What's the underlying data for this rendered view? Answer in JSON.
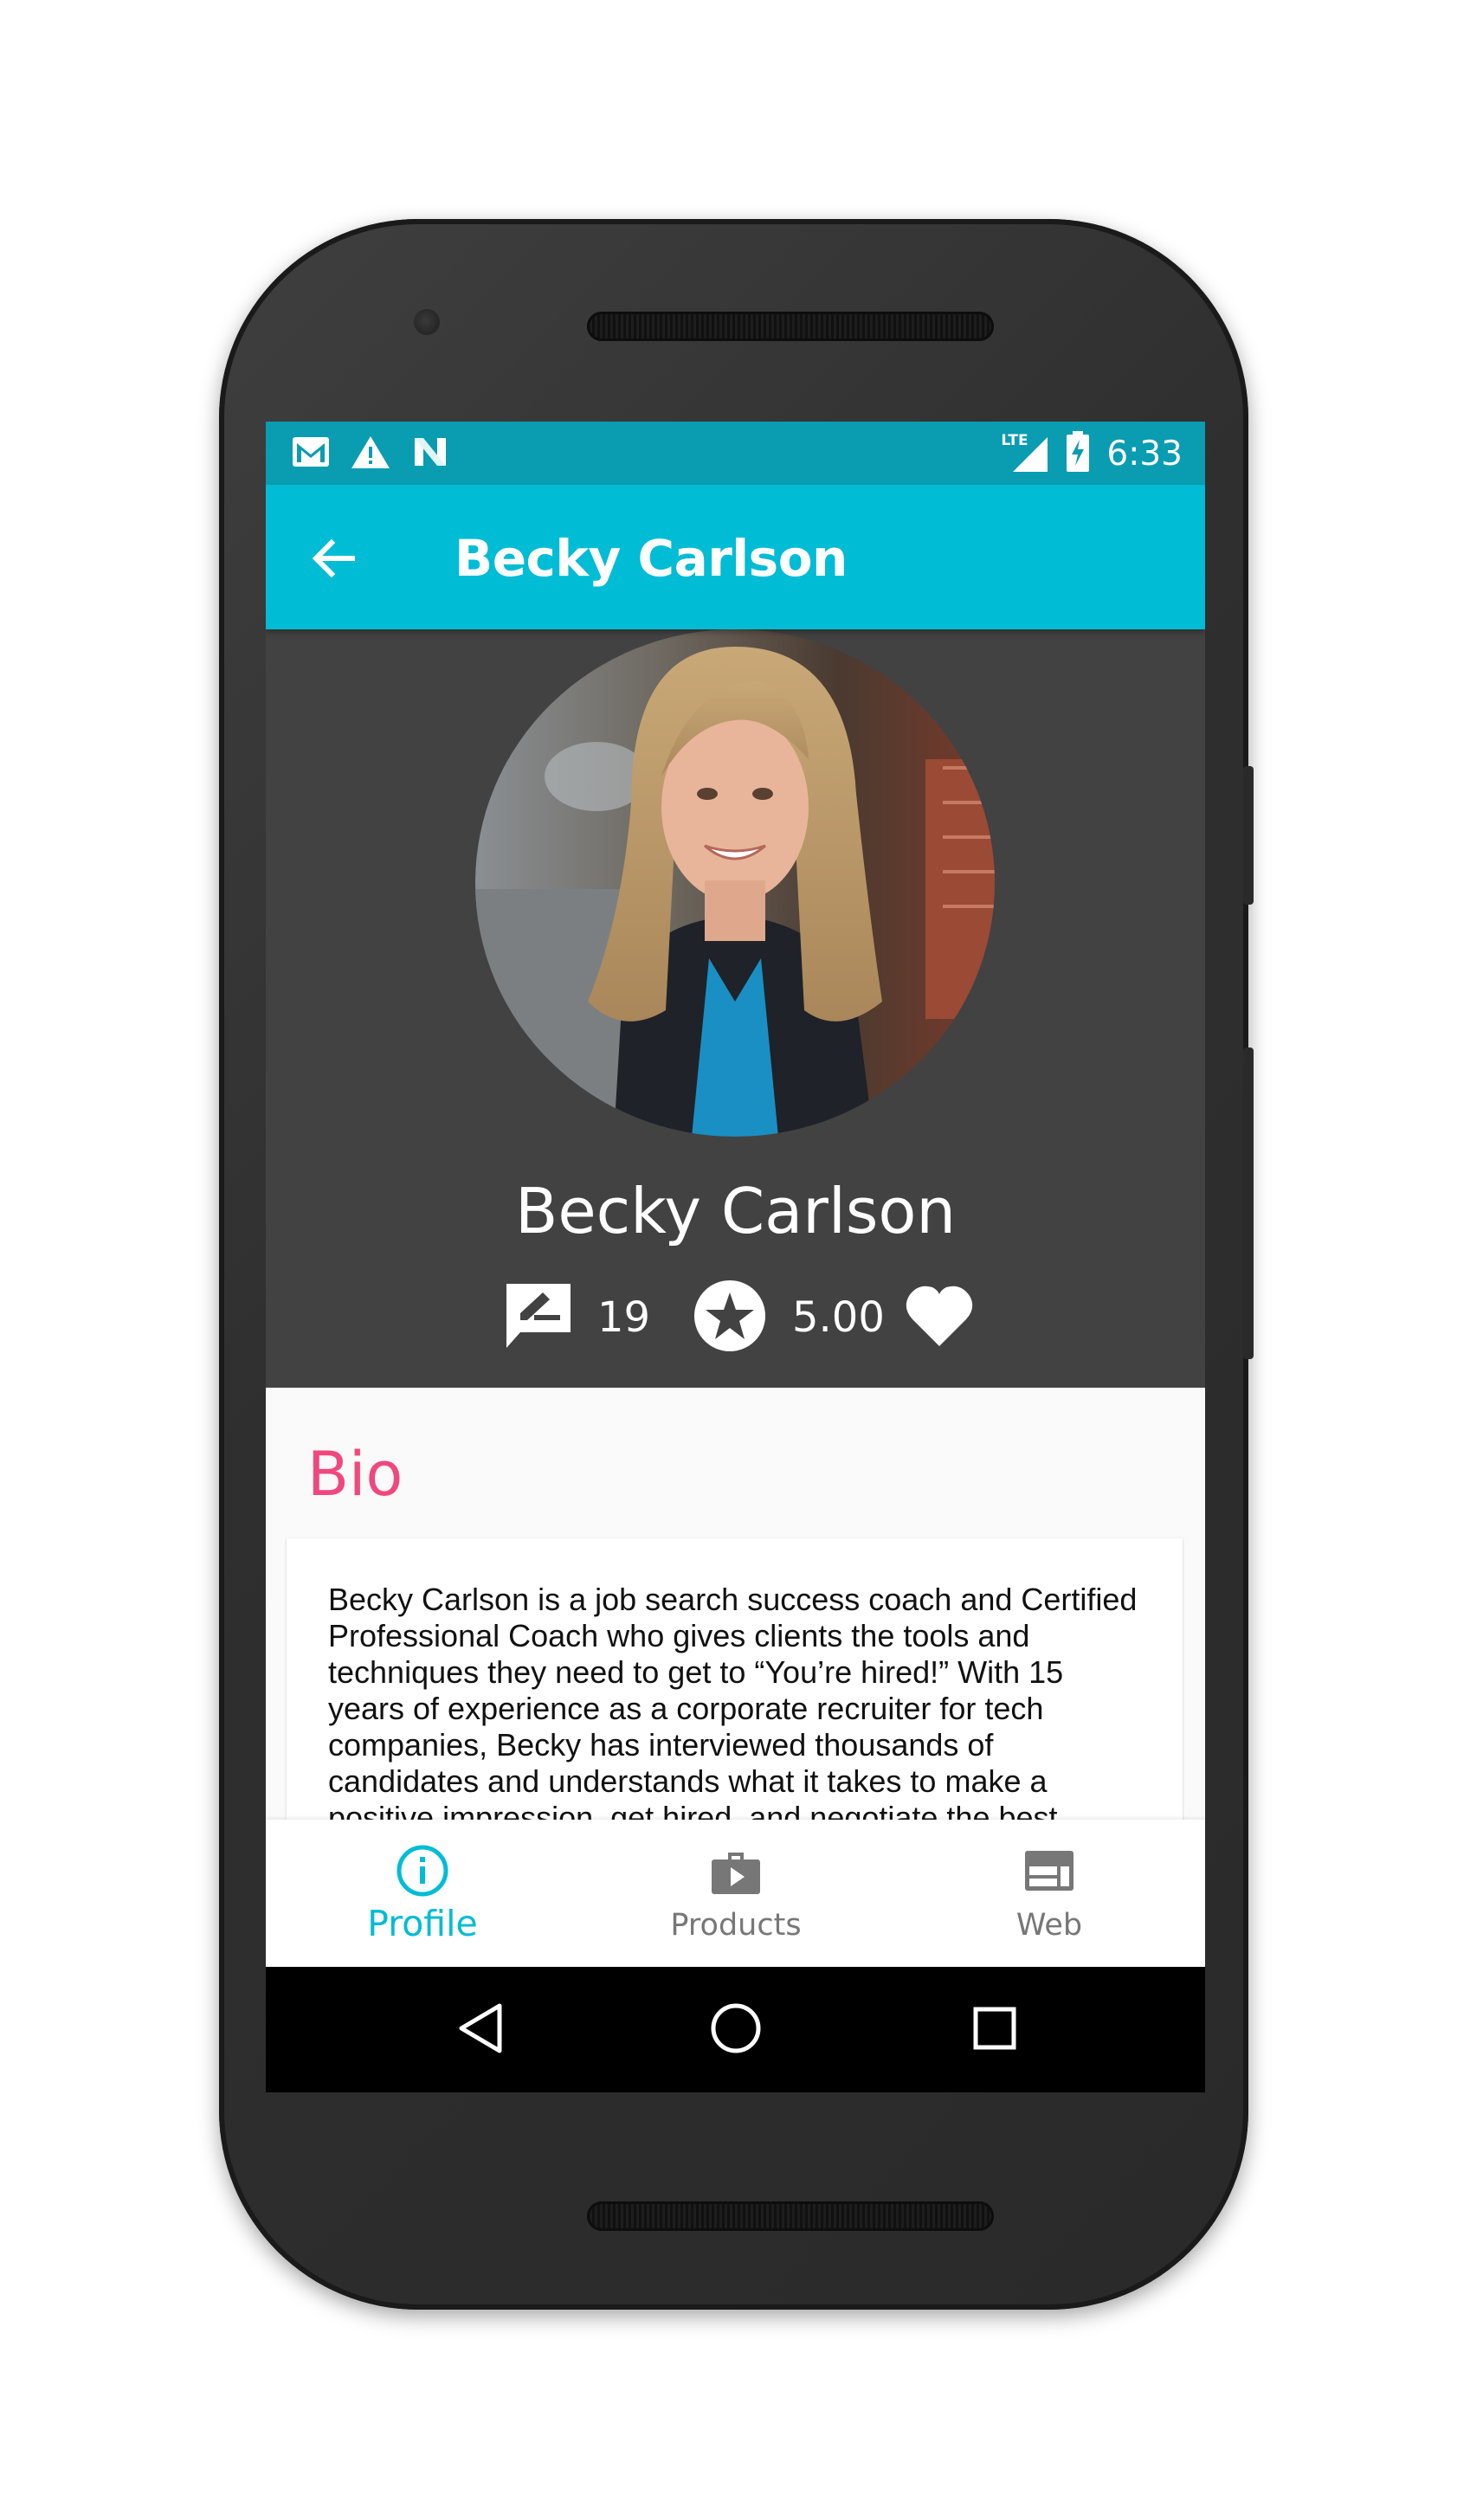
{
  "status_bar": {
    "time": "6:33",
    "network": "LTE",
    "left_icons": [
      "gmail-icon",
      "warning-icon",
      "n-app-icon"
    ],
    "right_icons": [
      "lte-signal-icon",
      "battery-charging-icon"
    ]
  },
  "app_bar": {
    "title": "Becky Carlson",
    "back_icon": "arrow-back-icon",
    "color": "#00bcd4"
  },
  "profile": {
    "name": "Becky Carlson",
    "reviews_count": "19",
    "rating": "5.00",
    "favorite_icon": "heart-icon"
  },
  "bio": {
    "title": "Bio",
    "text": "Becky Carlson is a job search success coach and Certified Professional Coach who gives clients the tools and techniques they need to get to “You’re hired!” With 15 years of experience as a corporate recruiter for tech companies, Becky has interviewed thousands of candidates and understands what it takes to make a positive impression, get hired, and negotiate the best"
  },
  "bottom_nav": {
    "items": [
      {
        "label": "Profile",
        "icon": "info-icon",
        "active": true
      },
      {
        "label": "Products",
        "icon": "briefcase-icon",
        "active": false
      },
      {
        "label": "Web",
        "icon": "web-icon",
        "active": false
      }
    ]
  },
  "system_nav": [
    "back-triangle-icon",
    "home-circle-icon",
    "recents-square-icon"
  ],
  "colors": {
    "status_bar": "#0a9cb0",
    "accent": "#00bcd4",
    "header_bg": "#424242",
    "bio_title": "#f0487e"
  }
}
